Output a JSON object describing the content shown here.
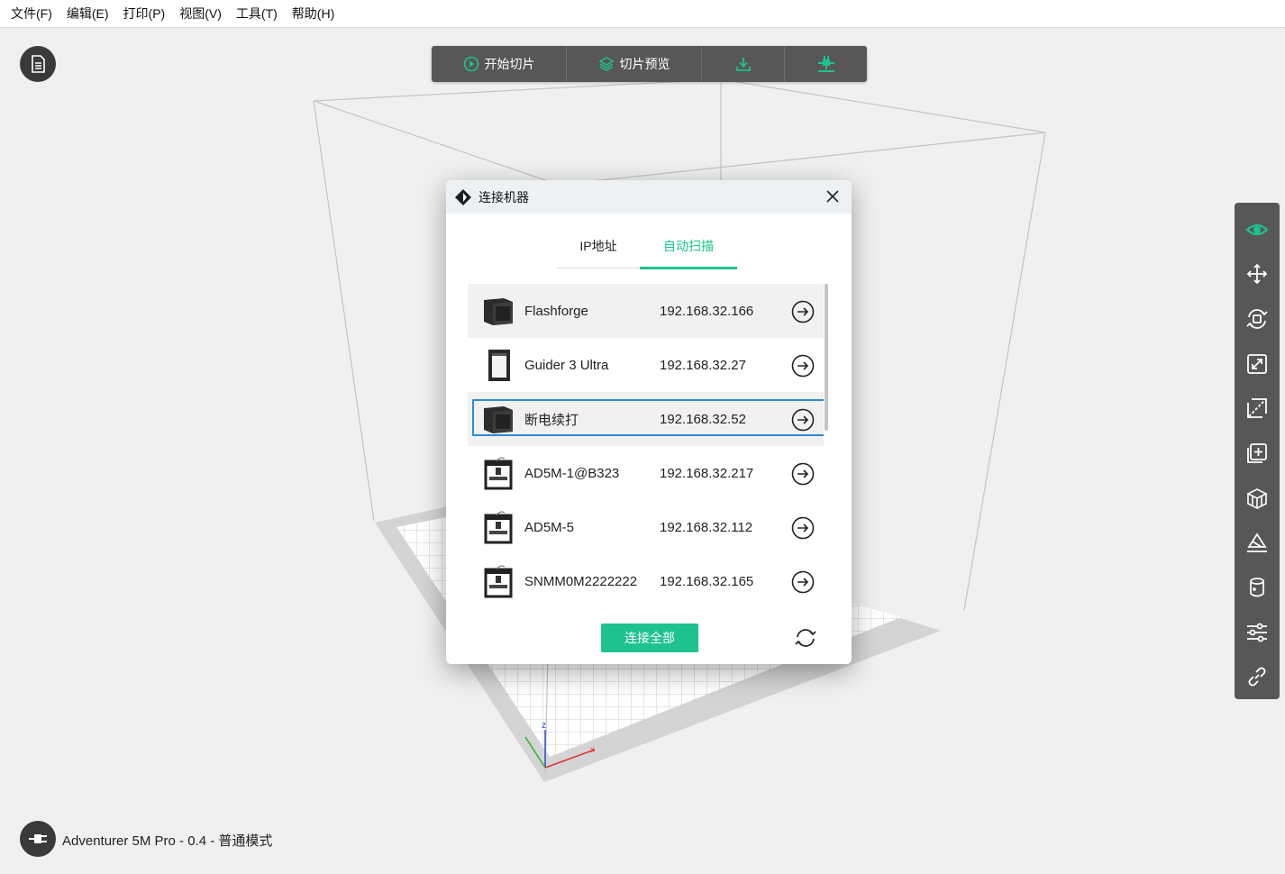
{
  "menu": [
    {
      "label": "文件(F)"
    },
    {
      "label": "编辑(E)"
    },
    {
      "label": "打印(P)"
    },
    {
      "label": "视图(V)"
    },
    {
      "label": "工具(T)"
    },
    {
      "label": "帮助(H)"
    }
  ],
  "toolbar": {
    "start_slice": "开始切片",
    "slice_preview": "切片预览"
  },
  "status": {
    "text": "Adventurer 5M Pro - 0.4 - 普通模式"
  },
  "dialog": {
    "title": "连接机器",
    "tabs": [
      "IP地址",
      "自动扫描"
    ],
    "active_tab": "自动扫描",
    "printers": [
      {
        "name": "Flashforge",
        "ip": "192.168.32.166",
        "model_icon": "box-printer-icon"
      },
      {
        "name": "Guider 3 Ultra",
        "ip": "192.168.32.27",
        "model_icon": "tall-printer-icon"
      },
      {
        "name": "断电续打",
        "ip": "192.168.32.52",
        "model_icon": "box-printer-icon"
      },
      {
        "name": "AD5M-1@B323",
        "ip": "192.168.32.217",
        "model_icon": "open-frame-printer-icon"
      },
      {
        "name": "AD5M-5",
        "ip": "192.168.32.112",
        "model_icon": "open-frame-printer-icon"
      },
      {
        "name": "SNMM0M2222222",
        "ip": "192.168.32.165",
        "model_icon": "open-frame-printer-icon"
      }
    ],
    "connect_all": "连接全部"
  },
  "colors": {
    "accent": "#1dc28f",
    "toolbar_bg": "#575757",
    "selection_border": "#2c8ad9"
  }
}
